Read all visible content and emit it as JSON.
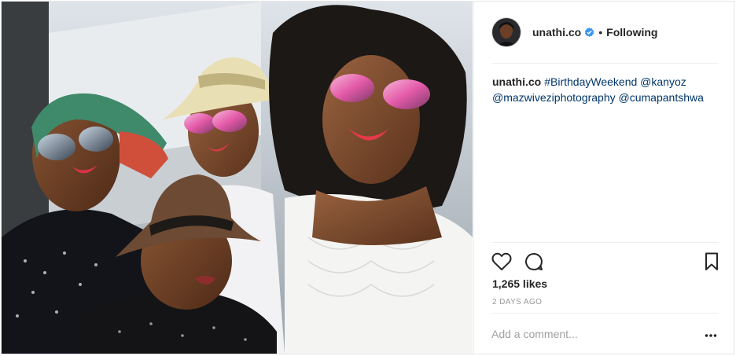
{
  "post": {
    "author": "unathi.co",
    "verified": true,
    "separator": "•",
    "follow_status": "Following",
    "caption": {
      "username": "unathi.co",
      "hashtag": "#BirthdayWeekend",
      "mention_1": "@kanyoz",
      "mention_2": "@mazwiveziphotography",
      "mention_3": "@cumapantshwa"
    },
    "likes": "1,265 likes",
    "timestamp": "2 DAYS AGO",
    "comment_placeholder": "Add a comment..."
  },
  "icons": {
    "like": "heart-icon",
    "comment": "speech-bubble-icon",
    "save": "bookmark-icon",
    "more": "ellipsis-icon",
    "verified": "verified-badge-icon"
  },
  "colors": {
    "link": "#003569",
    "verified_badge": "#3897f0",
    "timestamp": "#999999",
    "text": "#262626"
  }
}
